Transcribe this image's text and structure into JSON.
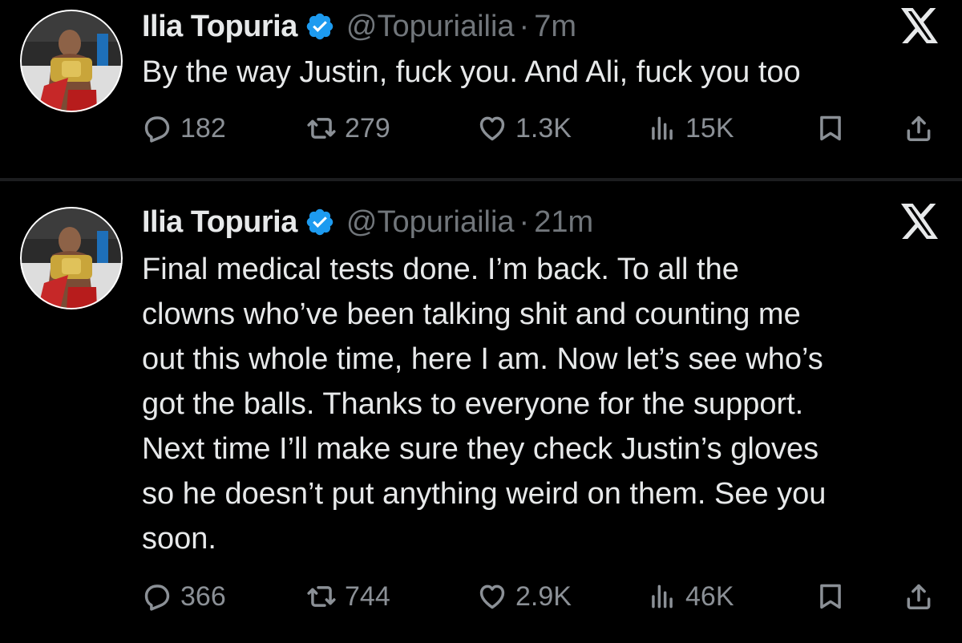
{
  "tweets": [
    {
      "author_name": "Ilia Topuria",
      "handle": "@Topuriailia",
      "separator": "·",
      "time": "7m",
      "text": "By the way Justin, fuck you. And Ali, fuck you too",
      "replies": "182",
      "retweets": "279",
      "likes": "1.3K",
      "views": "15K"
    },
    {
      "author_name": "Ilia Topuria",
      "handle": "@Topuriailia",
      "separator": "·",
      "time": "21m",
      "text": "Final medical tests done. I’m back. To all the\nclowns who’ve been talking shit and counting me\nout this whole time, here I am. Now let’s see who’s\ngot the balls. Thanks to everyone for the support.\nNext time I’ll make sure they check Justin’s gloves\nso he doesn’t put anything weird on them. See you\nsoon.",
      "replies": "366",
      "retweets": "744",
      "likes": "2.9K",
      "views": "46K"
    }
  ],
  "icons": {
    "verified": "verified-badge-icon",
    "brand": "x-logo-icon",
    "reply": "reply-icon",
    "retweet": "retweet-icon",
    "like": "heart-icon",
    "views": "views-chart-icon",
    "bookmark": "bookmark-icon",
    "share": "share-icon"
  },
  "colors": {
    "background": "#000000",
    "text": "#e7e9ea",
    "muted": "#71767b",
    "verified": "#1d9bf0",
    "avatar_ring": "#ffffff"
  }
}
